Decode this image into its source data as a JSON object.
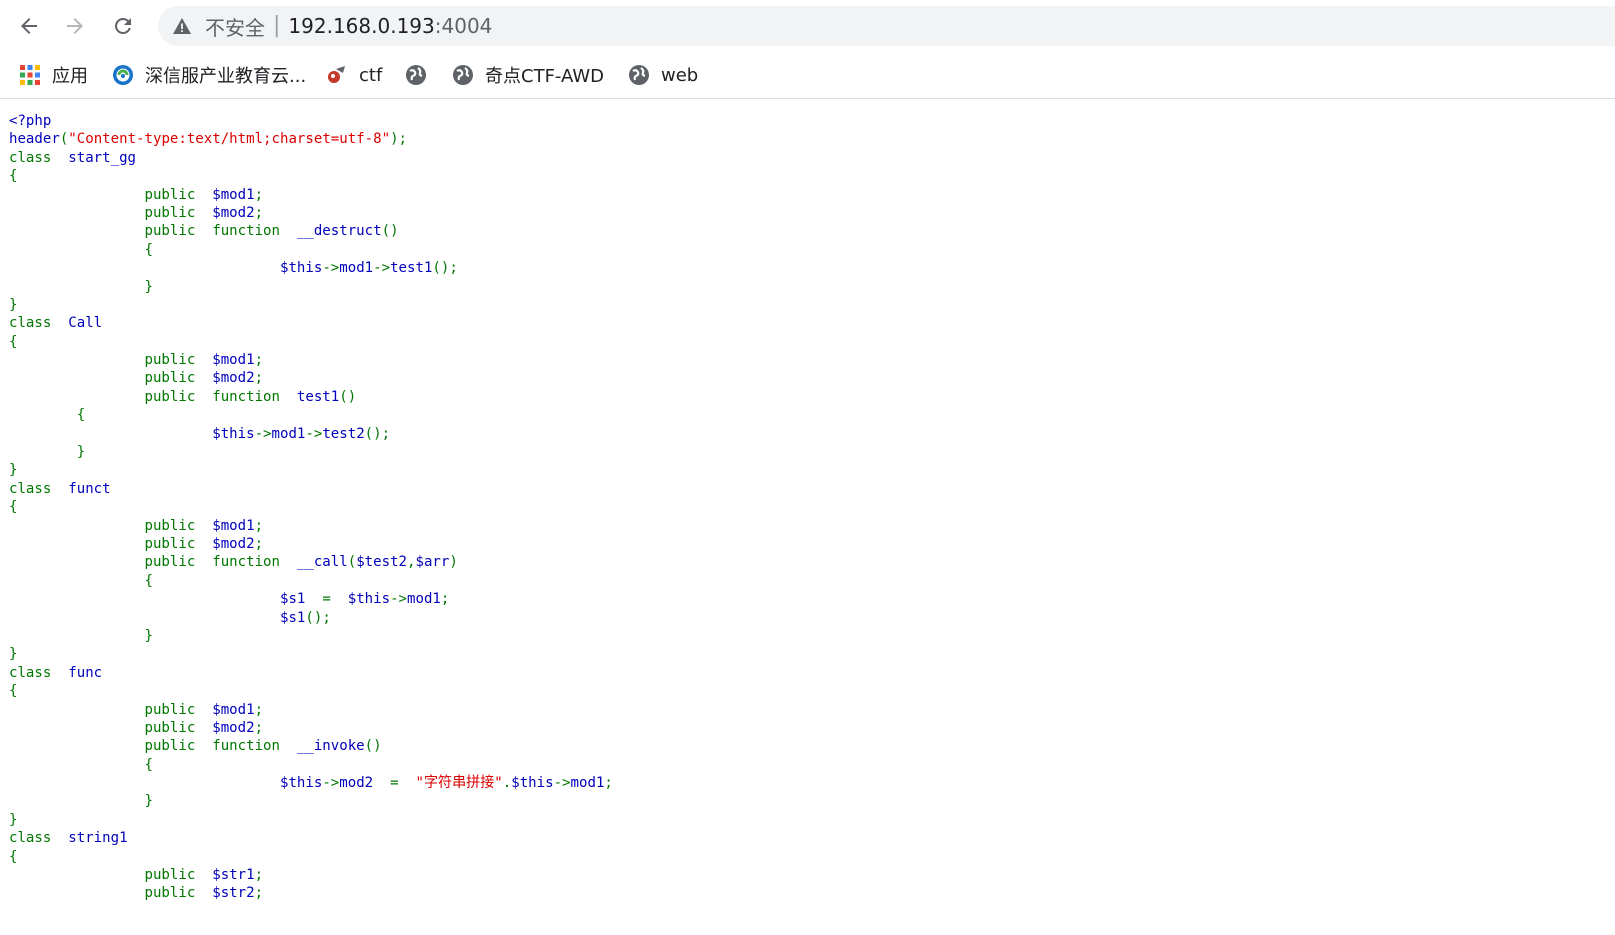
{
  "browser": {
    "security_label": "不安全",
    "url_host": "192.168.0.193",
    "url_port": ":4004"
  },
  "bookmarks": [
    {
      "icon": "apps-grid-icon",
      "label": "应用"
    },
    {
      "icon": "sangfor-logo-icon",
      "label": "深信服产业教育云..."
    },
    {
      "icon": "ctf-flag-icon",
      "label": "ctf"
    },
    {
      "icon": "globe-icon",
      "label": ""
    },
    {
      "icon": "globe-icon",
      "label": "奇点CTF-AWD"
    },
    {
      "icon": "globe-icon",
      "label": "web"
    }
  ],
  "colors": {
    "keyword": "#007700",
    "identifier": "#0000bb",
    "string": "#dd0000"
  },
  "code_lines": [
    [
      {
        "t": "<?php",
        "c": "df"
      }
    ],
    [
      {
        "t": "header",
        "c": "df"
      },
      {
        "t": "(",
        "c": "kw"
      },
      {
        "t": "\"Content-type:text/html;charset=utf-8\"",
        "c": "st"
      },
      {
        "t": ");",
        "c": "kw"
      }
    ],
    [
      {
        "t": "class  ",
        "c": "kw"
      },
      {
        "t": "start_gg",
        "c": "df"
      }
    ],
    [
      {
        "t": "{",
        "c": "kw"
      }
    ],
    [
      {
        "t": "                public  ",
        "c": "kw"
      },
      {
        "t": "$mod1",
        "c": "df"
      },
      {
        "t": ";",
        "c": "kw"
      }
    ],
    [
      {
        "t": "                public  ",
        "c": "kw"
      },
      {
        "t": "$mod2",
        "c": "df"
      },
      {
        "t": ";",
        "c": "kw"
      }
    ],
    [
      {
        "t": "                public  function  ",
        "c": "kw"
      },
      {
        "t": "__destruct",
        "c": "df"
      },
      {
        "t": "()",
        "c": "kw"
      }
    ],
    [
      {
        "t": "                {",
        "c": "kw"
      }
    ],
    [
      {
        "t": "                                ",
        "c": "kw"
      },
      {
        "t": "$this",
        "c": "df"
      },
      {
        "t": "->",
        "c": "kw"
      },
      {
        "t": "mod1",
        "c": "df"
      },
      {
        "t": "->",
        "c": "kw"
      },
      {
        "t": "test1",
        "c": "df"
      },
      {
        "t": "();",
        "c": "kw"
      }
    ],
    [
      {
        "t": "                }",
        "c": "kw"
      }
    ],
    [
      {
        "t": "}",
        "c": "kw"
      }
    ],
    [
      {
        "t": "class  ",
        "c": "kw"
      },
      {
        "t": "Call",
        "c": "df"
      }
    ],
    [
      {
        "t": "{",
        "c": "kw"
      }
    ],
    [
      {
        "t": "                public  ",
        "c": "kw"
      },
      {
        "t": "$mod1",
        "c": "df"
      },
      {
        "t": ";",
        "c": "kw"
      }
    ],
    [
      {
        "t": "                public  ",
        "c": "kw"
      },
      {
        "t": "$mod2",
        "c": "df"
      },
      {
        "t": ";",
        "c": "kw"
      }
    ],
    [
      {
        "t": "                public  function  ",
        "c": "kw"
      },
      {
        "t": "test1",
        "c": "df"
      },
      {
        "t": "()",
        "c": "kw"
      }
    ],
    [
      {
        "t": "        {",
        "c": "kw"
      }
    ],
    [
      {
        "t": "                        ",
        "c": "kw"
      },
      {
        "t": "$this",
        "c": "df"
      },
      {
        "t": "->",
        "c": "kw"
      },
      {
        "t": "mod1",
        "c": "df"
      },
      {
        "t": "->",
        "c": "kw"
      },
      {
        "t": "test2",
        "c": "df"
      },
      {
        "t": "();",
        "c": "kw"
      }
    ],
    [
      {
        "t": "        }",
        "c": "kw"
      }
    ],
    [
      {
        "t": "}",
        "c": "kw"
      }
    ],
    [
      {
        "t": "class  ",
        "c": "kw"
      },
      {
        "t": "funct",
        "c": "df"
      }
    ],
    [
      {
        "t": "{",
        "c": "kw"
      }
    ],
    [
      {
        "t": "                public  ",
        "c": "kw"
      },
      {
        "t": "$mod1",
        "c": "df"
      },
      {
        "t": ";",
        "c": "kw"
      }
    ],
    [
      {
        "t": "                public  ",
        "c": "kw"
      },
      {
        "t": "$mod2",
        "c": "df"
      },
      {
        "t": ";",
        "c": "kw"
      }
    ],
    [
      {
        "t": "                public  function  ",
        "c": "kw"
      },
      {
        "t": "__call",
        "c": "df"
      },
      {
        "t": "(",
        "c": "kw"
      },
      {
        "t": "$test2",
        "c": "df"
      },
      {
        "t": ",",
        "c": "kw"
      },
      {
        "t": "$arr",
        "c": "df"
      },
      {
        "t": ")",
        "c": "kw"
      }
    ],
    [
      {
        "t": "                {",
        "c": "kw"
      }
    ],
    [
      {
        "t": "                                ",
        "c": "kw"
      },
      {
        "t": "$s1  ",
        "c": "df"
      },
      {
        "t": "=  ",
        "c": "kw"
      },
      {
        "t": "$this",
        "c": "df"
      },
      {
        "t": "->",
        "c": "kw"
      },
      {
        "t": "mod1",
        "c": "df"
      },
      {
        "t": ";",
        "c": "kw"
      }
    ],
    [
      {
        "t": "                                ",
        "c": "kw"
      },
      {
        "t": "$s1",
        "c": "df"
      },
      {
        "t": "();",
        "c": "kw"
      }
    ],
    [
      {
        "t": "                }",
        "c": "kw"
      }
    ],
    [
      {
        "t": "}",
        "c": "kw"
      }
    ],
    [
      {
        "t": "class  ",
        "c": "kw"
      },
      {
        "t": "func",
        "c": "df"
      }
    ],
    [
      {
        "t": "{",
        "c": "kw"
      }
    ],
    [
      {
        "t": "                public  ",
        "c": "kw"
      },
      {
        "t": "$mod1",
        "c": "df"
      },
      {
        "t": ";",
        "c": "kw"
      }
    ],
    [
      {
        "t": "                public  ",
        "c": "kw"
      },
      {
        "t": "$mod2",
        "c": "df"
      },
      {
        "t": ";",
        "c": "kw"
      }
    ],
    [
      {
        "t": "                public  function  ",
        "c": "kw"
      },
      {
        "t": "__invoke",
        "c": "df"
      },
      {
        "t": "()",
        "c": "kw"
      }
    ],
    [
      {
        "t": "                {",
        "c": "kw"
      }
    ],
    [
      {
        "t": "                                ",
        "c": "kw"
      },
      {
        "t": "$this",
        "c": "df"
      },
      {
        "t": "->",
        "c": "kw"
      },
      {
        "t": "mod2  ",
        "c": "df"
      },
      {
        "t": "=  ",
        "c": "kw"
      },
      {
        "t": "\"字符串拼接\"",
        "c": "st"
      },
      {
        "t": ".",
        "c": "kw"
      },
      {
        "t": "$this",
        "c": "df"
      },
      {
        "t": "->",
        "c": "kw"
      },
      {
        "t": "mod1",
        "c": "df"
      },
      {
        "t": ";",
        "c": "kw"
      }
    ],
    [
      {
        "t": "                }",
        "c": "kw"
      }
    ],
    [
      {
        "t": "}",
        "c": "kw"
      }
    ],
    [
      {
        "t": "class  ",
        "c": "kw"
      },
      {
        "t": "string1",
        "c": "df"
      }
    ],
    [
      {
        "t": "{",
        "c": "kw"
      }
    ],
    [
      {
        "t": "                public  ",
        "c": "kw"
      },
      {
        "t": "$str1",
        "c": "df"
      },
      {
        "t": ";",
        "c": "kw"
      }
    ],
    [
      {
        "t": "                public  ",
        "c": "kw"
      },
      {
        "t": "$str2",
        "c": "df"
      },
      {
        "t": ";",
        "c": "kw"
      }
    ]
  ]
}
